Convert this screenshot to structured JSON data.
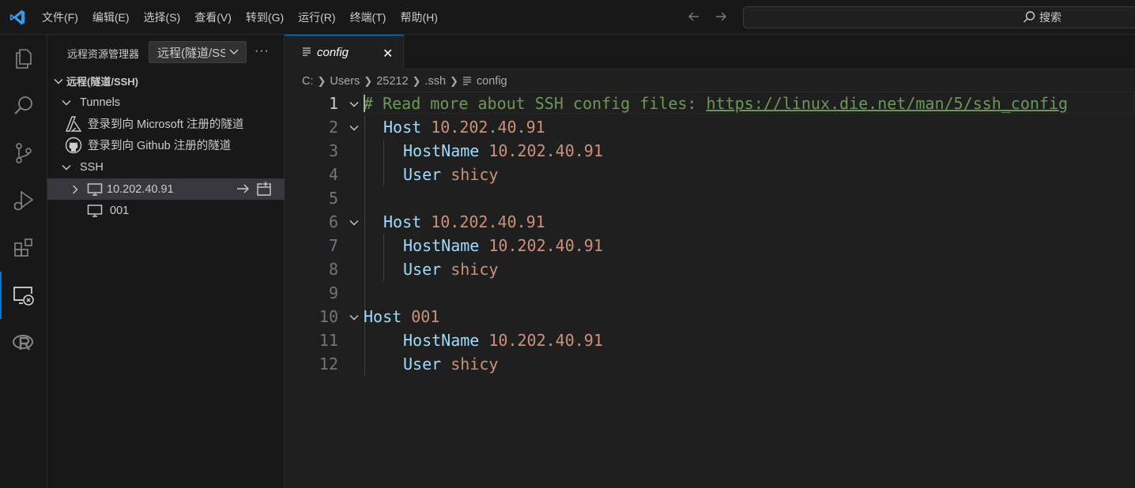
{
  "menu": [
    "文件(F)",
    "编辑(E)",
    "选择(S)",
    "查看(V)",
    "转到(G)",
    "运行(R)",
    "终端(T)",
    "帮助(H)"
  ],
  "search": {
    "label": "搜索"
  },
  "activity_bar": [
    "explorer",
    "search",
    "source-control",
    "run-and-debug",
    "extensions",
    "remote-explorer",
    "r-language"
  ],
  "sidebar": {
    "title": "远程资源管理器",
    "select_value": "远程(隧道/SSH)",
    "more": "···",
    "section_title": "远程(隧道/SSH)",
    "tunnels_label": "Tunnels",
    "tunnel_microsoft": "登录到向 Microsoft 注册的隧道",
    "tunnel_github": "登录到向 Github 注册的隧道",
    "ssh_label": "SSH",
    "hosts": [
      "10.202.40.91",
      "001"
    ]
  },
  "editor": {
    "tab_label": "config",
    "breadcrumb": [
      "C:",
      "Users",
      "25212",
      ".ssh",
      "config"
    ],
    "lines": [
      {
        "n": "1",
        "text": [
          "# Read more about SSH config files: ",
          "https://linux.die.net/man/5/ssh_config"
        ]
      },
      {
        "n": "2",
        "text": [
          "Host",
          " 10.202.40.91"
        ]
      },
      {
        "n": "3",
        "text": [
          "HostName",
          " 10.202.40.91"
        ]
      },
      {
        "n": "4",
        "text": [
          "User",
          " shicy"
        ]
      },
      {
        "n": "5",
        "text": [
          "",
          ""
        ]
      },
      {
        "n": "6",
        "text": [
          "Host",
          " 10.202.40.91"
        ]
      },
      {
        "n": "7",
        "text": [
          "HostName",
          " 10.202.40.91"
        ]
      },
      {
        "n": "8",
        "text": [
          "User",
          " shicy"
        ]
      },
      {
        "n": "9",
        "text": [
          "",
          ""
        ]
      },
      {
        "n": "10",
        "text": [
          "Host",
          " 001"
        ]
      },
      {
        "n": "11",
        "text": [
          "HostName",
          " 10.202.40.91"
        ]
      },
      {
        "n": "12",
        "text": [
          "User",
          " shicy"
        ]
      }
    ]
  }
}
